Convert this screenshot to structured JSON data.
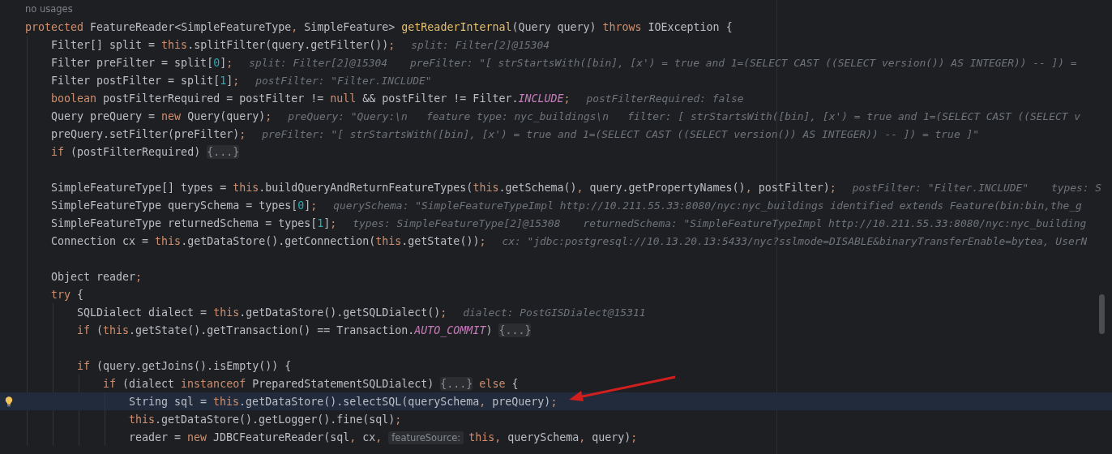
{
  "editor": {
    "usage": "no usages",
    "lines": [
      {
        "kind": "code",
        "current": false,
        "tokens": [
          {
            "kind": "kw",
            "text": "protected "
          },
          {
            "kind": "plain",
            "text": "FeatureReader<SimpleFeatureType"
          },
          {
            "kind": "punct",
            "text": ", "
          },
          {
            "kind": "plain",
            "text": "SimpleFeature> "
          },
          {
            "kind": "decl",
            "text": "getReaderInternal"
          },
          {
            "kind": "plain",
            "text": "(Query query) "
          },
          {
            "kind": "kw",
            "text": "throws "
          },
          {
            "kind": "plain",
            "text": "IOException {"
          }
        ],
        "children": [
          {
            "kind": "code",
            "current": false,
            "tokens": [
              {
                "kind": "plain",
                "text": "Filter[] split = "
              },
              {
                "kind": "kw",
                "text": "this"
              },
              {
                "kind": "plain",
                "text": ".splitFilter(query.getFilter())"
              },
              {
                "kind": "punct",
                "text": ";"
              }
            ],
            "hints": [
              "split: Filter[2]@15304"
            ]
          },
          {
            "kind": "code",
            "current": false,
            "tokens": [
              {
                "kind": "plain",
                "text": "Filter preFilter = split["
              },
              {
                "kind": "num",
                "text": "0"
              },
              {
                "kind": "plain",
                "text": "]"
              },
              {
                "kind": "punct",
                "text": ";"
              }
            ],
            "hints": [
              "split: Filter[2]@15304",
              "preFilter: \"[ strStartsWith([bin], [x') = true and 1=(SELECT CAST ((SELECT version()) AS INTEGER)) -- ]) ="
            ]
          },
          {
            "kind": "code",
            "current": false,
            "tokens": [
              {
                "kind": "plain",
                "text": "Filter postFilter = split["
              },
              {
                "kind": "num",
                "text": "1"
              },
              {
                "kind": "plain",
                "text": "]"
              },
              {
                "kind": "punct",
                "text": ";"
              }
            ],
            "hints": [
              "postFilter: \"Filter.INCLUDE\""
            ]
          },
          {
            "kind": "code",
            "current": false,
            "tokens": [
              {
                "kind": "kw",
                "text": "boolean "
              },
              {
                "kind": "plain",
                "text": "postFilterRequired = postFilter != "
              },
              {
                "kind": "kw",
                "text": "null "
              },
              {
                "kind": "plain",
                "text": "&& postFilter != Filter."
              },
              {
                "kind": "const",
                "text": "INCLUDE"
              },
              {
                "kind": "punct",
                "text": ";"
              }
            ],
            "hints": [
              "postFilterRequired: false"
            ]
          },
          {
            "kind": "code",
            "current": false,
            "tokens": [
              {
                "kind": "plain",
                "text": "Query preQuery = "
              },
              {
                "kind": "kw",
                "text": "new "
              },
              {
                "kind": "plain",
                "text": "Query(query)"
              },
              {
                "kind": "punct",
                "text": ";"
              }
            ],
            "hints": [
              "preQuery: \"Query:\\n   feature type: nyc_buildings\\n   filter: [ strStartsWith([bin], [x') = true and 1=(SELECT CAST ((SELECT v"
            ]
          },
          {
            "kind": "code",
            "current": false,
            "tokens": [
              {
                "kind": "plain",
                "text": "preQuery.setFilter(preFilter)"
              },
              {
                "kind": "punct",
                "text": ";"
              }
            ],
            "hints": [
              "preFilter: \"[ strStartsWith([bin], [x') = true and 1=(SELECT CAST ((SELECT version()) AS INTEGER)) -- ]) = true ]\""
            ]
          },
          {
            "kind": "code",
            "current": false,
            "tokens": [
              {
                "kind": "kw",
                "text": "if "
              },
              {
                "kind": "plain",
                "text": "(postFilterRequired) "
              },
              {
                "kind": "fold",
                "text": "{...}"
              }
            ]
          },
          {
            "kind": "blank",
            "current": false
          },
          {
            "kind": "code",
            "current": false,
            "tokens": [
              {
                "kind": "plain",
                "text": "SimpleFeatureType[] types = "
              },
              {
                "kind": "kw",
                "text": "this"
              },
              {
                "kind": "plain",
                "text": ".buildQueryAndReturnFeatureTypes("
              },
              {
                "kind": "kw",
                "text": "this"
              },
              {
                "kind": "plain",
                "text": ".getSchema()"
              },
              {
                "kind": "punct",
                "text": ", "
              },
              {
                "kind": "plain",
                "text": "query.getPropertyNames()"
              },
              {
                "kind": "punct",
                "text": ", "
              },
              {
                "kind": "plain",
                "text": "postFilter)"
              },
              {
                "kind": "punct",
                "text": ";"
              }
            ],
            "hints": [
              "postFilter: \"Filter.INCLUDE\"",
              "types: S"
            ]
          },
          {
            "kind": "code",
            "current": false,
            "tokens": [
              {
                "kind": "plain",
                "text": "SimpleFeatureType querySchema = types["
              },
              {
                "kind": "num",
                "text": "0"
              },
              {
                "kind": "plain",
                "text": "]"
              },
              {
                "kind": "punct",
                "text": ";"
              }
            ],
            "hints": [
              "querySchema: \"SimpleFeatureTypeImpl http://10.211.55.33:8080/nyc:nyc_buildings identified extends Feature(bin:bin,the_g"
            ]
          },
          {
            "kind": "code",
            "current": false,
            "tokens": [
              {
                "kind": "plain",
                "text": "SimpleFeatureType returnedSchema = types["
              },
              {
                "kind": "num",
                "text": "1"
              },
              {
                "kind": "plain",
                "text": "]"
              },
              {
                "kind": "punct",
                "text": ";"
              }
            ],
            "hints": [
              "types: SimpleFeatureType[2]@15308",
              "returnedSchema: \"SimpleFeatureTypeImpl http://10.211.55.33:8080/nyc:nyc_building"
            ]
          },
          {
            "kind": "code",
            "current": false,
            "tokens": [
              {
                "kind": "plain",
                "text": "Connection cx = "
              },
              {
                "kind": "kw",
                "text": "this"
              },
              {
                "kind": "plain",
                "text": ".getDataStore().getConnection("
              },
              {
                "kind": "kw",
                "text": "this"
              },
              {
                "kind": "plain",
                "text": ".getState())"
              },
              {
                "kind": "punct",
                "text": ";"
              }
            ],
            "hints": [
              "cx: \"jdbc:postgresql://10.13.20.13:5433/nyc?sslmode=DISABLE&binaryTransferEnable=bytea, UserN"
            ]
          },
          {
            "kind": "blank",
            "current": false
          },
          {
            "kind": "code",
            "current": false,
            "tokens": [
              {
                "kind": "plain",
                "text": "Object reader"
              },
              {
                "kind": "punct",
                "text": ";"
              }
            ]
          },
          {
            "kind": "code",
            "current": false,
            "tokens": [
              {
                "kind": "kw",
                "text": "try "
              },
              {
                "kind": "plain",
                "text": "{"
              }
            ],
            "children": [
              {
                "kind": "code",
                "current": false,
                "tokens": [
                  {
                    "kind": "plain",
                    "text": "SQLDialect dialect = "
                  },
                  {
                    "kind": "kw",
                    "text": "this"
                  },
                  {
                    "kind": "plain",
                    "text": ".getDataStore().getSQLDialect()"
                  },
                  {
                    "kind": "punct",
                    "text": ";"
                  }
                ],
                "hints": [
                  "dialect: PostGISDialect@15311"
                ]
              },
              {
                "kind": "code",
                "current": false,
                "tokens": [
                  {
                    "kind": "kw",
                    "text": "if "
                  },
                  {
                    "kind": "plain",
                    "text": "("
                  },
                  {
                    "kind": "kw",
                    "text": "this"
                  },
                  {
                    "kind": "plain",
                    "text": ".getState().getTransaction() == Transaction."
                  },
                  {
                    "kind": "const",
                    "text": "AUTO_COMMIT"
                  },
                  {
                    "kind": "plain",
                    "text": ") "
                  },
                  {
                    "kind": "fold",
                    "text": "{...}"
                  }
                ]
              },
              {
                "kind": "blank",
                "current": false
              },
              {
                "kind": "code",
                "current": false,
                "tokens": [
                  {
                    "kind": "kw",
                    "text": "if "
                  },
                  {
                    "kind": "plain",
                    "text": "(query.getJoins().isEmpty()) {"
                  }
                ],
                "children": [
                  {
                    "kind": "code",
                    "current": false,
                    "tokens": [
                      {
                        "kind": "kw",
                        "text": "if "
                      },
                      {
                        "kind": "plain",
                        "text": "(dialect "
                      },
                      {
                        "kind": "kw",
                        "text": "instanceof "
                      },
                      {
                        "kind": "plain",
                        "text": "PreparedStatementSQLDialect) "
                      },
                      {
                        "kind": "fold",
                        "text": "{...}"
                      },
                      {
                        "kind": "kw",
                        "text": " else "
                      },
                      {
                        "kind": "plain",
                        "text": "{"
                      }
                    ],
                    "children": [
                      {
                        "kind": "code",
                        "current": true,
                        "tokens": [
                          {
                            "kind": "plain",
                            "text": "String sql = "
                          },
                          {
                            "kind": "kw",
                            "text": "this"
                          },
                          {
                            "kind": "plain",
                            "text": ".getDataStore().selectSQL(querySchema"
                          },
                          {
                            "kind": "punct",
                            "text": ", "
                          },
                          {
                            "kind": "plain",
                            "text": "preQuery)"
                          },
                          {
                            "kind": "punct",
                            "text": ";"
                          }
                        ]
                      },
                      {
                        "kind": "code",
                        "current": false,
                        "tokens": [
                          {
                            "kind": "kw",
                            "text": "this"
                          },
                          {
                            "kind": "plain",
                            "text": ".getDataStore().getLogger().fine(sql)"
                          },
                          {
                            "kind": "punct",
                            "text": ";"
                          }
                        ]
                      },
                      {
                        "kind": "code",
                        "current": false,
                        "tokens": [
                          {
                            "kind": "plain",
                            "text": "reader = "
                          },
                          {
                            "kind": "kw",
                            "text": "new "
                          },
                          {
                            "kind": "plain",
                            "text": "JDBCFeatureReader(sql"
                          },
                          {
                            "kind": "punct",
                            "text": ", "
                          },
                          {
                            "kind": "plain",
                            "text": "cx"
                          },
                          {
                            "kind": "punct",
                            "text": ", "
                          },
                          {
                            "kind": "param",
                            "text": "featureSource:"
                          },
                          {
                            "kind": "kw",
                            "text": "this"
                          },
                          {
                            "kind": "punct",
                            "text": ", "
                          },
                          {
                            "kind": "plain",
                            "text": "querySchema"
                          },
                          {
                            "kind": "punct",
                            "text": ", "
                          },
                          {
                            "kind": "plain",
                            "text": "query)"
                          },
                          {
                            "kind": "punct",
                            "text": ";"
                          }
                        ]
                      }
                    ]
                  }
                ]
              }
            ]
          }
        ]
      }
    ]
  }
}
